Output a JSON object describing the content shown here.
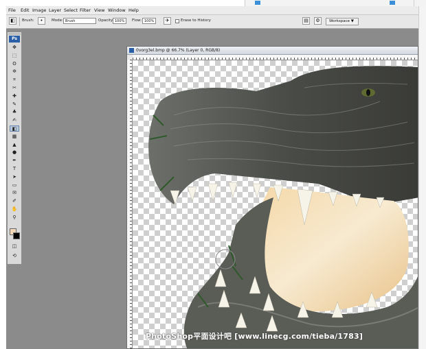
{
  "app": {
    "menu": [
      "File",
      "Edit",
      "Image",
      "Layer",
      "Select",
      "Filter",
      "View",
      "Window",
      "Help"
    ]
  },
  "options_bar": {
    "brush_label": "Brush:",
    "mode_label": "Mode:",
    "mode_value": "Brush",
    "opacity_label": "Opacity:",
    "opacity_value": "100%",
    "flow_label": "Flow:",
    "flow_value": "100%",
    "erase_to_history": "Erase to History",
    "workspace": "Workspace ▼"
  },
  "tools": {
    "ps_badge": "Ps",
    "icons": [
      "move-icon",
      "marquee-icon",
      "lasso-icon",
      "magic-wand-icon",
      "crop-icon",
      "slice-icon",
      "healing-icon",
      "brush-icon",
      "stamp-icon",
      "history-brush-icon",
      "eraser-icon",
      "gradient-icon",
      "blur-icon",
      "dodge-icon",
      "pen-icon",
      "type-icon",
      "path-select-icon",
      "shape-icon",
      "notes-icon",
      "eyedropper-icon",
      "hand-icon",
      "zoom-icon"
    ],
    "glyphs": [
      "✥",
      "⬚",
      "ʘ",
      "✲",
      "⌗",
      "✂",
      "✚",
      "✎",
      "♣",
      "✍",
      "◧",
      "▦",
      "▲",
      "●",
      "✒",
      "T",
      "➤",
      "▭",
      "✉",
      "✐",
      "✋",
      "⚲"
    ],
    "selected_index": 10,
    "extra_glyphs": [
      "◫",
      "⟲"
    ]
  },
  "document": {
    "title": "0vorg3el.bmp @ 66.7% (Layer 0, RGB/8)"
  },
  "watermark": "PhotoShop平面设计吧 [www.linecg.com/tieba/1783]",
  "colors": {
    "foreground": "#f1d6b8",
    "background": "#000000"
  }
}
